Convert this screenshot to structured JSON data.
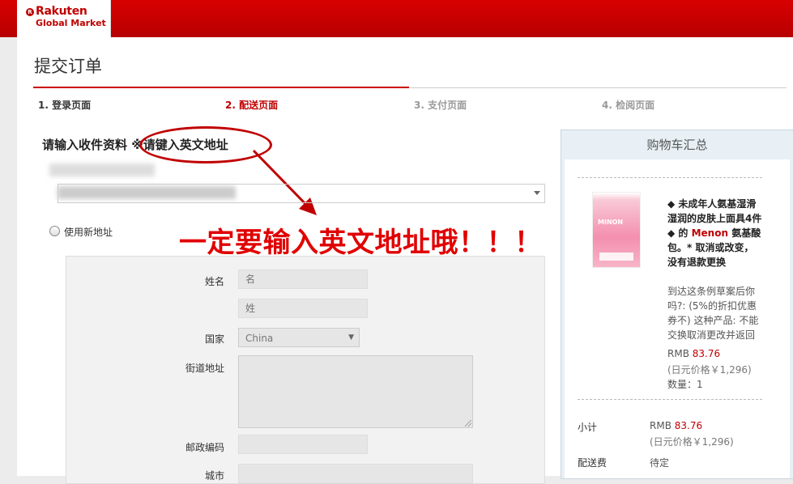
{
  "brand": {
    "logo_top": "Rakuten",
    "logo_bottom": "Global Market",
    "logo_mark": "R"
  },
  "page_title": "提交订单",
  "steps": [
    {
      "label": "1. 登录页面",
      "state": "done"
    },
    {
      "label": "2. 配送页面",
      "state": "active"
    },
    {
      "label": "3. 支付页面",
      "state": "pending"
    },
    {
      "label": "4. 检阅页面",
      "state": "pending"
    }
  ],
  "section_heading": "请输入收件资料 ※请键入英文地址",
  "annotation": "一定要输入英文地址哦！！！",
  "new_address_option": "使用新地址",
  "form": {
    "name_label": "姓名",
    "first_name_placeholder": "名",
    "last_name_placeholder": "姓",
    "country_label": "国家",
    "country_value": "China",
    "street_label": "街道地址",
    "postal_label": "邮政编码",
    "city_label": "城市"
  },
  "cart": {
    "title": "购物车汇总",
    "product_name_parts": [
      "◆ 未成年人氨基湿滑湿润的皮肤上面具4件 ◆ 的 ",
      "Menon",
      " 氨基酸包。* 取消或改变，没有退款更换"
    ],
    "product_image_text": "MINON",
    "product_note": "到达这条例草案后你吗?: (5%的折扣优惠券不) 这种产品: 不能交换取消更改并返回",
    "price_prefix": "RMB ",
    "price_value": "83.76",
    "jpy_price": "(日元价格￥1,296)",
    "qty": "数量：1",
    "subtotal_label": "小计",
    "subtotal_prefix": "RMB ",
    "subtotal_value": "83.76",
    "subtotal_jpy": "(日元价格￥1,296)",
    "shipping_label": "配送费",
    "shipping_value": "待定"
  },
  "colors": {
    "brand_red": "#bf0000",
    "annotation_red": "#e00000",
    "sidebar_bg": "#e8f0f5"
  }
}
